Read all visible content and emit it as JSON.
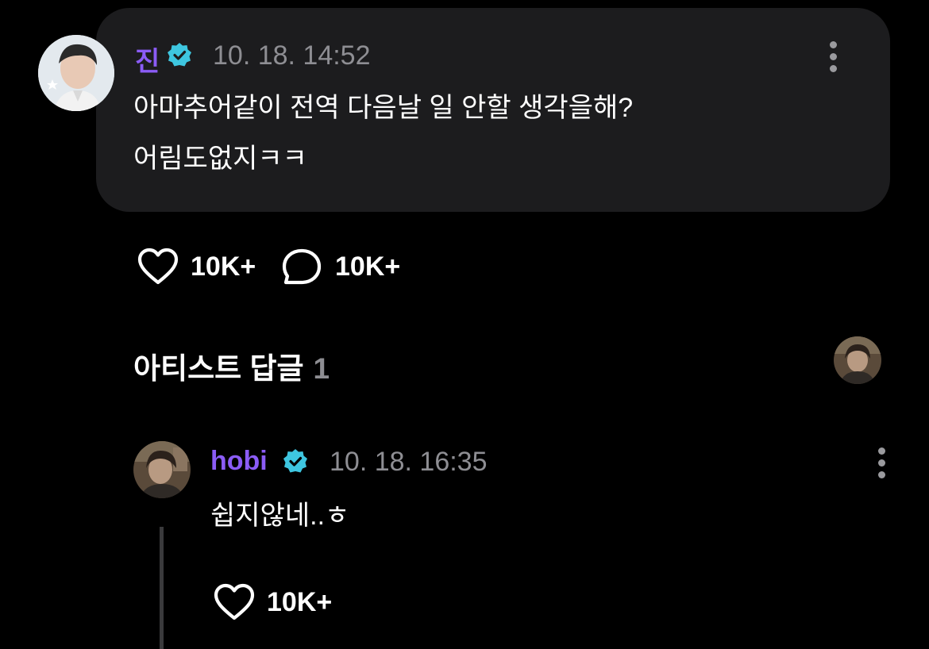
{
  "post": {
    "author": "진",
    "verified_icon": "verified-badge-icon",
    "timestamp": "10. 18. 14:52",
    "text_line1": "아마추어같이 전역 다음날 일 안할 생각을해?",
    "text_line2": "어림도없지ㅋㅋ",
    "like_count": "10K+",
    "comment_count": "10K+"
  },
  "replies_section": {
    "title": "아티스트 답글",
    "count": "1"
  },
  "reply": {
    "author": "hobi",
    "verified_icon": "verified-badge-icon",
    "timestamp": "10. 18. 16:35",
    "text": "쉽지않네..ㅎ",
    "like_count": "10K+"
  },
  "colors": {
    "accent": "#8b5cf6",
    "verified": "#3ec6e0",
    "bubble": "#1c1c1e",
    "muted": "#8e8e93"
  }
}
